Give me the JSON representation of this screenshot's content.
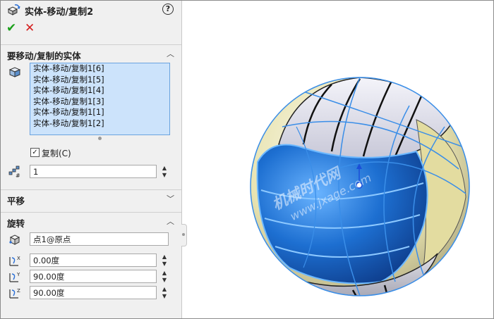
{
  "header": {
    "title": "实体-移动/复制2",
    "help": "?"
  },
  "actions": {
    "ok": "✔",
    "cancel": "✕"
  },
  "bodies_section": {
    "title": "要移动/复制的实体",
    "items": [
      "实体-移动/复制1[6]",
      "实体-移动/复制1[5]",
      "实体-移动/复制1[4]",
      "实体-移动/复制1[3]",
      "实体-移动/复制1[1]",
      "实体-移动/复制1[2]"
    ],
    "copy_checkbox": {
      "label": "复制(C)",
      "checked": true,
      "mark": "✓"
    },
    "copies_count": "1"
  },
  "translate_section": {
    "title": "平移"
  },
  "rotate_section": {
    "title": "旋转",
    "point": "点1@原点",
    "x_angle": "0.00度",
    "y_angle": "90.00度",
    "z_angle": "90.00度"
  },
  "watermark": {
    "line1": "机械时代网",
    "line2": "www.jxage.com"
  },
  "colors": {
    "selection_blue": "#cce3fb",
    "accent": "#3a8ee8",
    "ok": "#1aa01a",
    "cancel": "#d42020"
  }
}
